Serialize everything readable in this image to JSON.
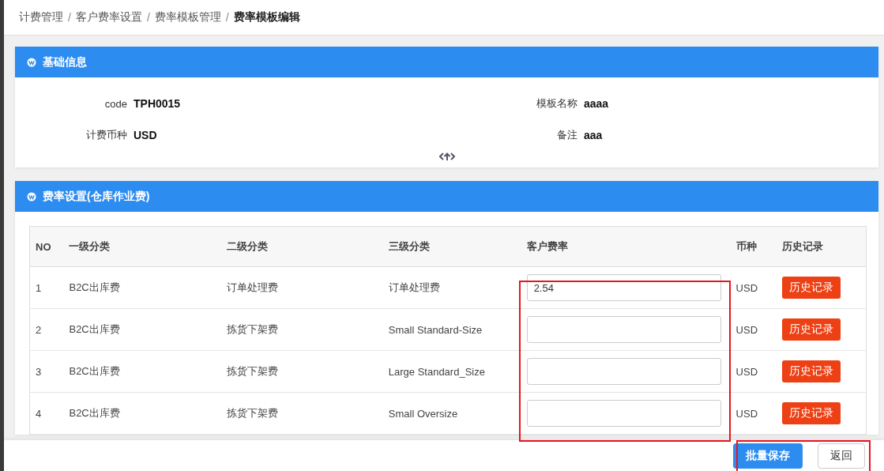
{
  "breadcrumb_separator": "/",
  "breadcrumb": [
    {
      "label": "计费管理",
      "current": false
    },
    {
      "label": "客户费率设置",
      "current": false
    },
    {
      "label": "费率模板管理",
      "current": false
    },
    {
      "label": "费率模板编辑",
      "current": true
    }
  ],
  "basic_panel": {
    "title": "基础信息",
    "fields": [
      {
        "label": "code",
        "value": "TPH0015"
      },
      {
        "label": "模板名称",
        "value": "aaaa"
      },
      {
        "label": "计费币种",
        "value": "USD"
      },
      {
        "label": "备注",
        "value": "aaa"
      }
    ]
  },
  "rate_panel": {
    "title": "费率设置(仓库作业费)",
    "columns": [
      "NO",
      "一级分类",
      "二级分类",
      "三级分类",
      "客户费率",
      "币种",
      "历史记录"
    ],
    "rows": [
      {
        "no": "1",
        "level1": "B2C出库费",
        "level2": "订单处理费",
        "level3": "订单处理费",
        "rate": "2.54",
        "currency": "USD",
        "history": "历史记录"
      },
      {
        "no": "2",
        "level1": "B2C出库费",
        "level2": "拣货下架费",
        "level3": "Small Standard-Size",
        "rate": "",
        "currency": "USD",
        "history": "历史记录"
      },
      {
        "no": "3",
        "level1": "B2C出库费",
        "level2": "拣货下架费",
        "level3": "Large Standard_Size",
        "rate": "",
        "currency": "USD",
        "history": "历史记录"
      },
      {
        "no": "4",
        "level1": "B2C出库费",
        "level2": "拣货下架费",
        "level3": "Small Oversize",
        "rate": "",
        "currency": "USD",
        "history": "历史记录"
      }
    ]
  },
  "footer": {
    "save": "批量保存",
    "back": "返回"
  }
}
